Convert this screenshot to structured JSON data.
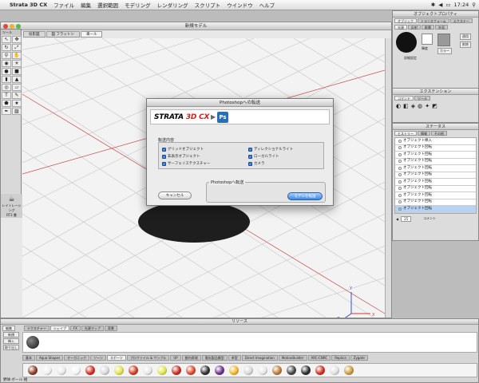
{
  "menubar": {
    "apple": "",
    "app_name": "Strata 3D CX",
    "items": [
      "ファイル",
      "編集",
      "選択範囲",
      "モデリング",
      "レンダリング",
      "スクリプト",
      "ウインドウ",
      "ヘルプ"
    ],
    "time": "17:24"
  },
  "main_window": {
    "title": "新規モデル",
    "view_tabs": [
      "投影図",
      "図 フラットシ",
      "来ール"
    ],
    "tool_palette_title": "ツール",
    "render_label": "レイトレーシング",
    "render_sub": "RT3 書"
  },
  "axis_labels": {
    "z": "Z",
    "x": "X",
    "y": "Y"
  },
  "dialog": {
    "title": "Photoshopへの転送",
    "brand_name": "STRATA",
    "brand_suffix": "3D CX",
    "ps_icon": "Ps",
    "section_label": "転送内容",
    "options": [
      {
        "label": "グリッドオブジェクト",
        "checked": true
      },
      {
        "label": "非表示オブジェクト",
        "checked": true
      },
      {
        "label": "サーフェイステクスチャー",
        "checked": true
      },
      {
        "label": "ディレクショナルライト",
        "checked": true
      },
      {
        "label": "ローカルライト",
        "checked": true
      },
      {
        "label": "カメラ",
        "checked": true
      }
    ],
    "send_group_label": "Photoshopへ転送",
    "cancel_label": "キャンセル",
    "ok_label": "モデルを転送"
  },
  "object_panel": {
    "title": "オブジェクトプロパティ",
    "tabs": [
      "オブジェク",
      "トランスフォーム",
      "エクステー"
    ],
    "sub_tabs": [
      "光源",
      "反射",
      "影響",
      "外見"
    ],
    "btn_apply": "適用",
    "btn_delete": "削除",
    "color_label": "カラー",
    "sample_label": "輝度",
    "footer": "詳細設定"
  },
  "extension_panel": {
    "title": "エクステンション",
    "tabs": [
      "コマンド",
      "ツール"
    ]
  },
  "status_panel": {
    "title": "ステータス",
    "tabs": [
      "ヒストリー",
      "情報",
      "その他"
    ],
    "history": [
      "オブジェクト挿入",
      "オブジェクト回転",
      "オブジェクト回転",
      "オブジェクト回転",
      "オブジェクト回転",
      "オブジェクト回転",
      "オブジェクト回転",
      "オブジェクト回転",
      "オブジェクト回転",
      "オブジェクト回転",
      "オブジェクト回転"
    ],
    "zoom": "25",
    "comment_label": "コメント"
  },
  "resource_panel": {
    "title": "リソース",
    "left_tabs": [
      "編集"
    ],
    "type_tabs": [
      "テクスチャー",
      "シェイプ",
      "FX",
      "光源マップ",
      "背景"
    ],
    "left_buttons": [
      "新規",
      "挿入",
      "取り出し"
    ],
    "category_tabs": [
      "基本",
      "Aqua Shapes",
      "オーガニック",
      "ソーン",
      "スポーツ",
      "プロファイル & サンプル",
      "UP",
      "都内再現",
      "電化製品模型",
      "卓室",
      "Direct Imagination",
      "MotionBuilder",
      "ARC-CNRC",
      "Replica",
      "Zygote"
    ],
    "status": "野球-ボール-紺",
    "ball_colors": [
      "#8a3a22",
      "#f0f0f0",
      "#e8e8e8",
      "#f4f4f4",
      "#d42b1e",
      "#d8d8d8",
      "#dfe24a",
      "#d13b1e",
      "#e6e6e6",
      "#dfe54c",
      "#c42b20",
      "#d9472a",
      "#2d2d2d",
      "#6a2f8c",
      "#f2b52a",
      "#d8d8d8",
      "#e6e6e6",
      "#b87a3a",
      "#444444",
      "#2a2a2a",
      "#d32a1e",
      "#e0e0e0",
      "#c89a3a"
    ]
  },
  "colors": {
    "accent_blue": "#2e6fcf",
    "strata_red": "#d41e1e",
    "ps_blue": "#2a6fb5"
  }
}
